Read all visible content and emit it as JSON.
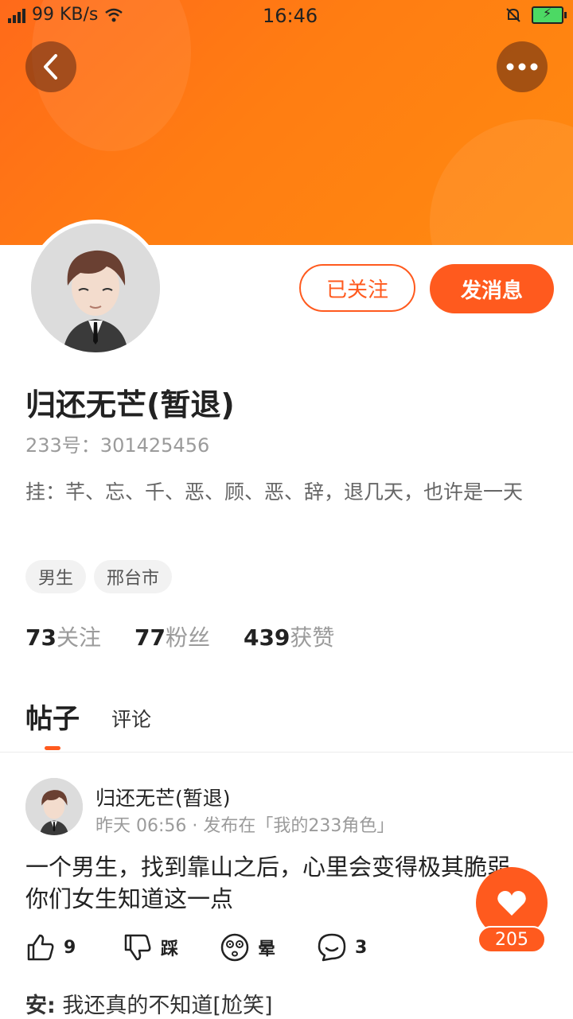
{
  "status_bar": {
    "net_speed": "99 KB/s",
    "time": "16:46"
  },
  "profile": {
    "follow_label": "已关注",
    "message_label": "发消息",
    "name": "归还无芒(暂退)",
    "uid": "233号：301425456",
    "bio": "挂：芊、忘、千、恶、顾、恶、辞，退几天，也许是一天",
    "tags": [
      "男生",
      "邢台市"
    ],
    "stats": [
      {
        "num": "73",
        "label": "关注"
      },
      {
        "num": "77",
        "label": "粉丝"
      },
      {
        "num": "439",
        "label": "获赞"
      }
    ]
  },
  "tabs": {
    "posts": "帖子",
    "comments": "评论"
  },
  "post": {
    "author": "归还无芒(暂退)",
    "meta": "昨天 06:56 · 发布在「我的233角色」",
    "text": "一个男生，找到靠山之后，心里会变得极其脆弱，你们女生知道这一点",
    "likes": "9",
    "dislike_label": "踩",
    "dizzy_label": "晕",
    "comments": "3",
    "comment_author": "安:",
    "comment_text": "我还真的不知道[尬笑]"
  },
  "fab": {
    "count": "205"
  },
  "colors": {
    "accent": "#ff5a1e",
    "banner": "#ff7d12"
  }
}
